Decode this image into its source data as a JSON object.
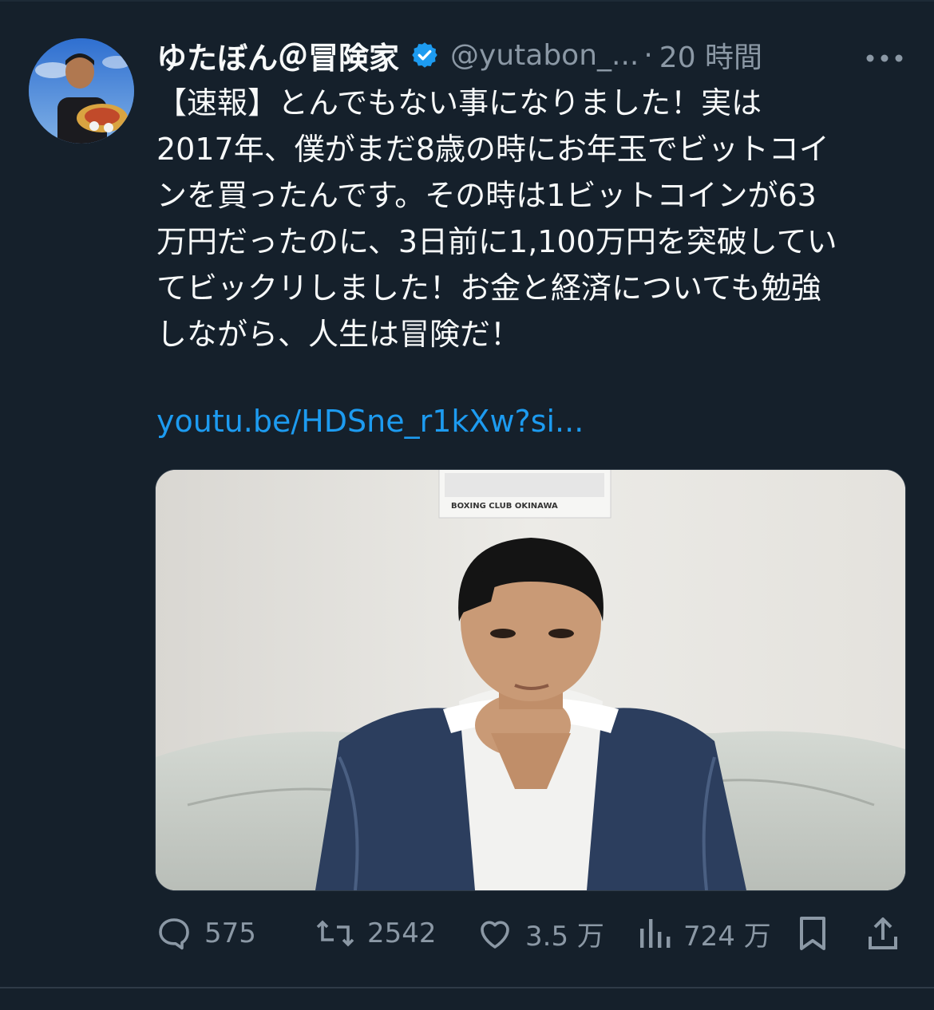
{
  "tweet": {
    "display_name": "ゆたぼん＠冒険家",
    "handle": "@yutabon_...",
    "separator": "·",
    "time": "20 時間",
    "body_lines": [
      "【速報】とんでもない事になりました！実は",
      "2017年、僕がまだ8歳の時にお年玉でビットコイ",
      "ンを買ったんです。その時は1ビットコインが63",
      "万円だったのに、3日前に1,100万円を突破してい",
      "てビックリしました！お金と経済についても勉強",
      "しながら、人生は冒険だ！"
    ],
    "link": "youtu.be/HDSne_r1kXw?si...",
    "media": {
      "poster_text": "BOXING CLUB OKINAWA"
    }
  },
  "actions": {
    "reply_count": "575",
    "retweet_count": "2542",
    "like_count": "3.5 万",
    "view_count": "724 万"
  },
  "icons": {
    "verified": "verified-badge-icon",
    "more": "more-icon",
    "reply": "reply-icon",
    "retweet": "retweet-icon",
    "like": "heart-icon",
    "views": "views-icon",
    "bookmark": "bookmark-icon",
    "share": "share-icon"
  },
  "colors": {
    "background": "#15202b",
    "text": "#f7f9f9",
    "muted": "#8b98a5",
    "link": "#1d9bf0",
    "verified": "#1d9bf0"
  }
}
